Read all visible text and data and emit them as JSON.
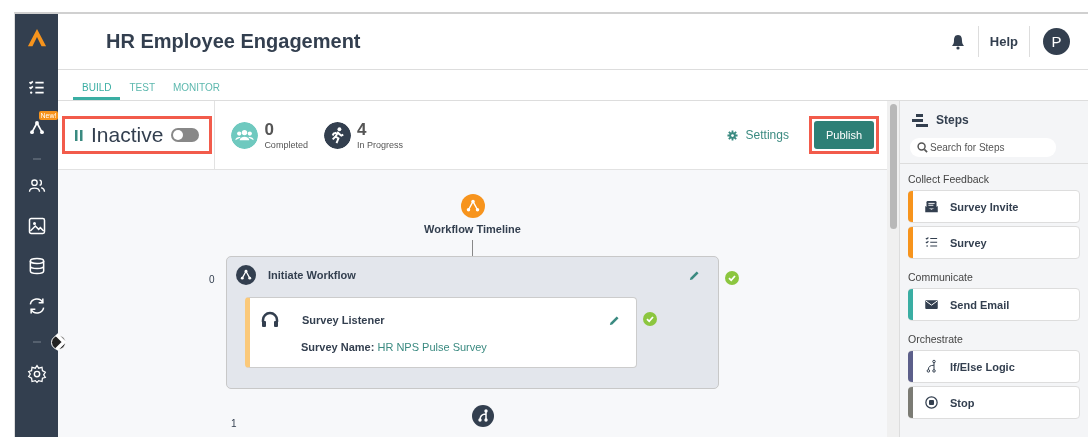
{
  "app": {
    "title": "HR Employee Engagement",
    "help": "Help",
    "avatar": "P"
  },
  "sidebar": {
    "badge": "New!"
  },
  "tabs": [
    {
      "label": "BUILD",
      "selected": true
    },
    {
      "label": "TEST",
      "selected": false
    },
    {
      "label": "MONITOR",
      "selected": false
    }
  ],
  "status": {
    "label": "Inactive",
    "active": false,
    "highlighted": true
  },
  "stats": [
    {
      "value": "0",
      "label": "Completed"
    },
    {
      "value": "4",
      "label": "In Progress"
    }
  ],
  "settings": "Settings",
  "publish": {
    "label": "Publish",
    "highlighted": true
  },
  "timeline": {
    "title": "Workflow Timeline"
  },
  "nodes": [
    {
      "index": "0",
      "title": "Initiate Workflow",
      "complete": true,
      "children": [
        {
          "title": "Survey Listener",
          "field": "Survey Name:",
          "value": "HR NPS Pulse Survey",
          "complete": true
        }
      ]
    },
    {
      "index": "1"
    }
  ],
  "steps_panel": {
    "title": "Steps",
    "search_placeholder": "Search for Steps",
    "groups": [
      {
        "name": "Collect Feedback",
        "items": [
          {
            "label": "Survey Invite",
            "color": "#f7941d"
          },
          {
            "label": "Survey",
            "color": "#f7941d"
          }
        ]
      },
      {
        "name": "Communicate",
        "items": [
          {
            "label": "Send Email",
            "color": "#3aaea3"
          }
        ]
      },
      {
        "name": "Orchestrate",
        "items": [
          {
            "label": "If/Else Logic",
            "color": "#5c5f8a"
          },
          {
            "label": "Stop",
            "color": "#7b7b74"
          }
        ]
      }
    ]
  }
}
